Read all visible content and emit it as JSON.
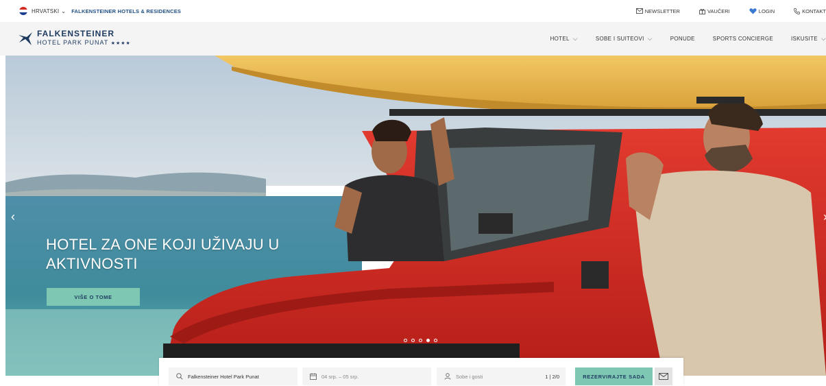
{
  "topbar": {
    "language": "HRVATSKI",
    "brand_link": "FALKENSTEINER HOTELS & RESIDENCES",
    "utilities": [
      {
        "label": "NEWSLETTER",
        "icon": "envelope-icon"
      },
      {
        "label": "VAUČERI",
        "icon": "gift-icon"
      },
      {
        "label": "LOGIN",
        "icon": "heart-icon"
      },
      {
        "label": "KONTAKT",
        "icon": "phone-icon"
      }
    ]
  },
  "logo": {
    "brand": "FALKENSTEINER",
    "property": "HOTEL PARK PUNAT",
    "stars": "★★★★"
  },
  "nav": {
    "items": [
      {
        "label": "HOTEL",
        "has_dropdown": true
      },
      {
        "label": "SOBE I SUITEOVI",
        "has_dropdown": true
      },
      {
        "label": "PONUDE",
        "has_dropdown": false
      },
      {
        "label": "SPORTS CONCIERGE",
        "has_dropdown": false
      },
      {
        "label": "ISKUSITE",
        "has_dropdown": true
      }
    ]
  },
  "hero": {
    "title": "HOTEL ZA ONE KOJI UŽIVAJU U AKTIVNOSTI",
    "button": "VIŠE O TOME",
    "slide_count": 5,
    "active_slide": 4
  },
  "booking": {
    "hotel": "Falkensteiner Hotel Park Punat",
    "dates": "04 srp. – 05 srp.",
    "guests_placeholder": "Sobe i gosti",
    "guests_count": "1 | 2/0",
    "cta": "REZERVIRAJTE SADA"
  },
  "colors": {
    "brand_navy": "#1d3a5f",
    "accent_mint": "#7ec7b3",
    "jeep_red": "#d42a22",
    "kayak_yellow": "#e9b84a"
  }
}
